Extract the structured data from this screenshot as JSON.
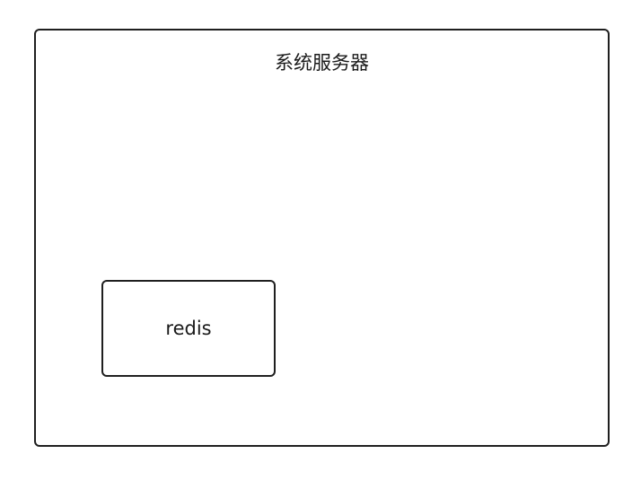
{
  "diagram": {
    "outer_node": {
      "label": "系统服务器"
    },
    "inner_node": {
      "label": "redis"
    }
  }
}
